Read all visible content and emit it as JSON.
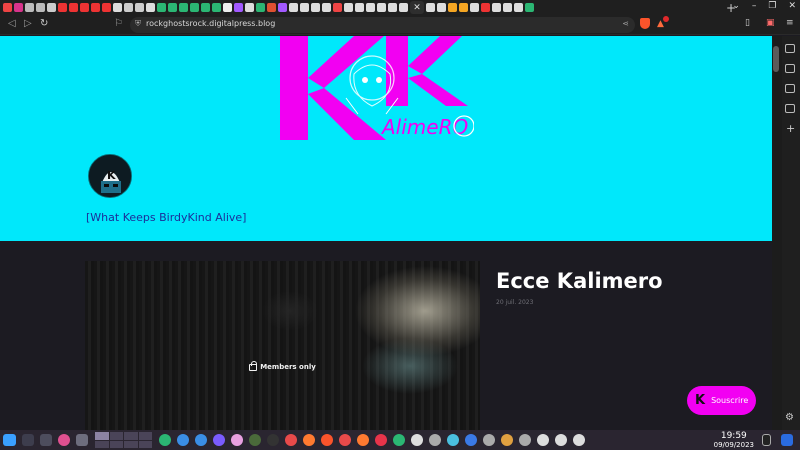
{
  "browser": {
    "url": "rockghostsrock.digitalpress.blog",
    "tab_count_visible": 47
  },
  "site": {
    "logo_text_big": "KK",
    "logo_wordmark": "AlimeRO",
    "avatar_letter": "K",
    "tagline": "[What Keeps BirdyKind Alive]"
  },
  "post": {
    "title": "Ecce Kalimero",
    "date": "20 juil. 2023",
    "members_label": "Members only"
  },
  "subscribe": {
    "icon_letter": "K",
    "label": "Souscrire"
  },
  "taskbar": {
    "time": "19:59",
    "date": "09/09/2023"
  },
  "colors": {
    "hero_bg": "#00e8fb",
    "accent_magenta": "#f200f2",
    "page_bg": "#1c1b22",
    "tagline": "#1a2e9a"
  }
}
